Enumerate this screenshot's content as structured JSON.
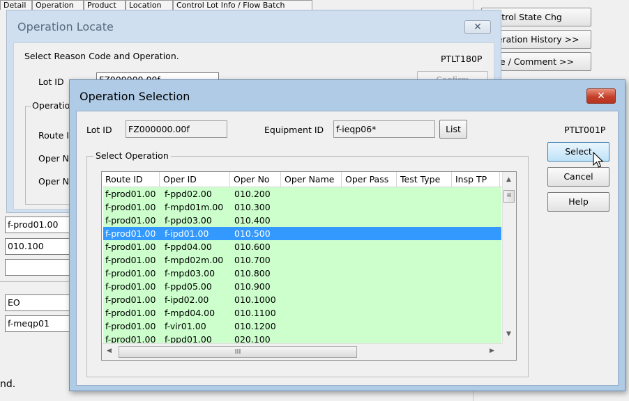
{
  "background": {
    "tabs": [
      "Detail",
      "Operation",
      "Product",
      "Location",
      "Control Lot Info / Flow Batch"
    ],
    "side_buttons": [
      "Control State Chg",
      "Operation History >>",
      "Note / Comment >>"
    ],
    "fields": [
      "f-prod01.00",
      "010.100",
      "",
      "EO",
      "f-meqp01"
    ],
    "status_text": "nd."
  },
  "locate_dialog": {
    "title": "Operation Locate",
    "close_symbol": "✕",
    "prompt": "Select Reason Code and Operation.",
    "screen_code": "PTLT180P",
    "lot_id_label": "Lot ID",
    "lot_id_value": "FZ000000.00f",
    "confirm_label": "Confirm",
    "group_label": "Operation",
    "route_label": "Route ID",
    "oper_no_label": "Oper No",
    "oper_name_label": "Oper Name"
  },
  "selection_dialog": {
    "title": "Operation Selection",
    "close_symbol": "✕",
    "lot_id_label": "Lot ID",
    "lot_id_value": "FZ000000.00f",
    "equipment_id_label": "Equipment ID",
    "equipment_id_value": "f-ieqp06*",
    "list_button": "List",
    "screen_code": "PTLT001P",
    "select_button": "Select",
    "cancel_button": "Cancel",
    "help_button": "Help",
    "group_label": "Select Operation",
    "columns": [
      "Route ID",
      "Oper ID",
      "Oper No",
      "Oper Name",
      "Oper Pass",
      "Test Type",
      "Insp TP"
    ],
    "rows": [
      {
        "route": "f-prod01.00",
        "oper_id": "f-ppd02.00",
        "oper_no": "010.200"
      },
      {
        "route": "f-prod01.00",
        "oper_id": "f-mpd01m.00",
        "oper_no": "010.300"
      },
      {
        "route": "f-prod01.00",
        "oper_id": "f-ppd03.00",
        "oper_no": "010.400"
      },
      {
        "route": "f-prod01.00",
        "oper_id": "f-ipd01.00",
        "oper_no": "010.500"
      },
      {
        "route": "f-prod01.00",
        "oper_id": "f-ppd04.00",
        "oper_no": "010.600"
      },
      {
        "route": "f-prod01.00",
        "oper_id": "f-mpd02m.00",
        "oper_no": "010.700"
      },
      {
        "route": "f-prod01.00",
        "oper_id": "f-mpd03.00",
        "oper_no": "010.800"
      },
      {
        "route": "f-prod01.00",
        "oper_id": "f-ppd05.00",
        "oper_no": "010.900"
      },
      {
        "route": "f-prod01.00",
        "oper_id": "f-ipd02.00",
        "oper_no": "010.1000"
      },
      {
        "route": "f-prod01.00",
        "oper_id": "f-mpd04.00",
        "oper_no": "010.1100"
      },
      {
        "route": "f-prod01.00",
        "oper_id": "f-vir01.00",
        "oper_no": "010.1200"
      },
      {
        "route": "f-prod01.00",
        "oper_id": "f-ppd01.00",
        "oper_no": "020.100"
      }
    ],
    "selected_row_index": 3,
    "scroll_up": "▲",
    "scroll_down": "▼",
    "scroll_left": "◀",
    "scroll_right": "▶",
    "thumb_grip": "III",
    "colors": {
      "row_background": "#ccffcc",
      "selected_background": "#3399ff",
      "title_bar": "#afcbe6",
      "close_button": "#c4402a"
    }
  }
}
